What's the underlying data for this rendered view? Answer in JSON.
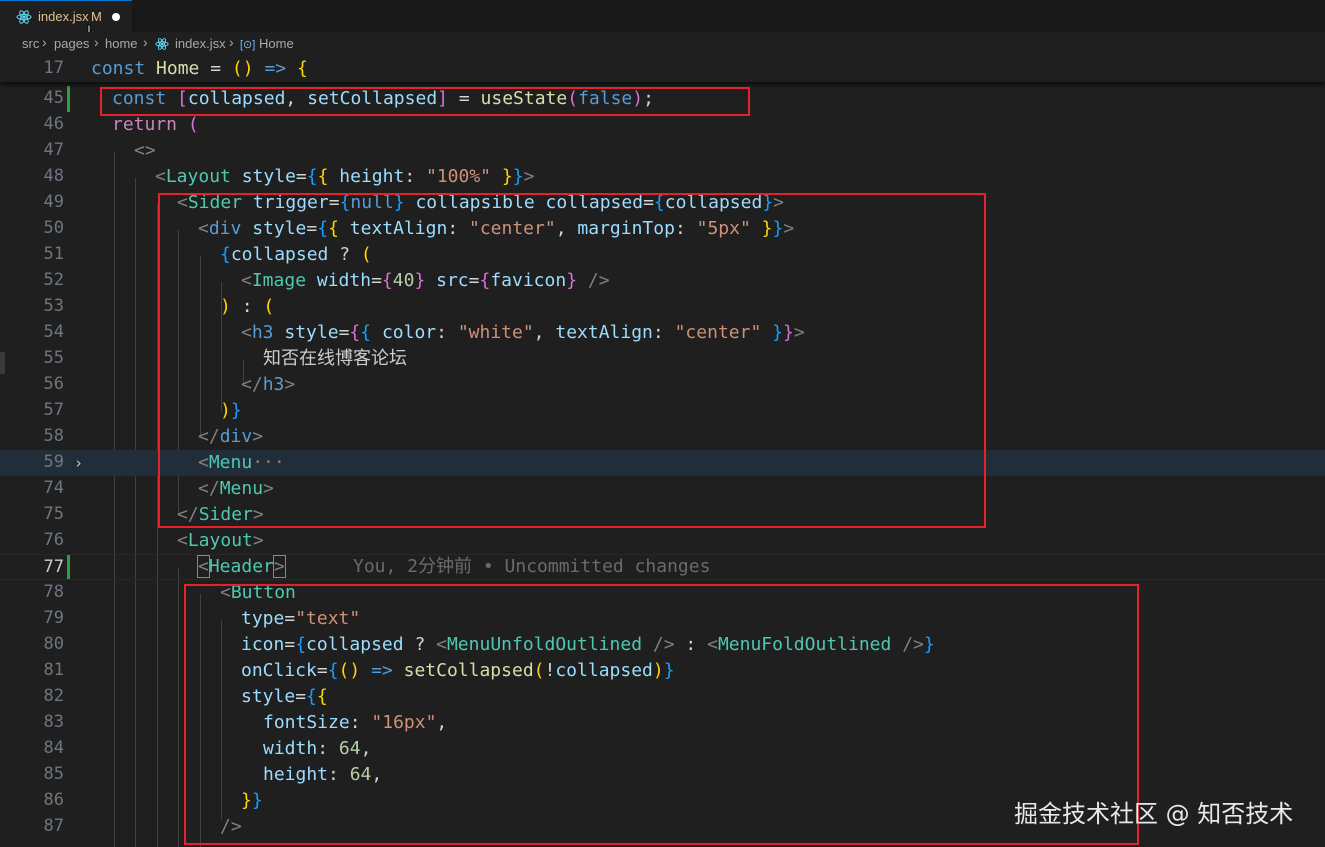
{
  "tab": {
    "filename": "index.jsx",
    "modified": "M"
  },
  "breadcrumb": {
    "parts": [
      "src",
      "pages",
      "home",
      "index.jsx",
      "Home"
    ]
  },
  "editor": {
    "sticky_line_number": "17",
    "line_numbers": [
      "45",
      "46",
      "47",
      "48",
      "49",
      "50",
      "51",
      "52",
      "53",
      "54",
      "55",
      "56",
      "57",
      "58",
      "59",
      "74",
      "75",
      "76",
      "77",
      "78",
      "79",
      "80",
      "81",
      "82",
      "83",
      "84",
      "85",
      "86",
      "87"
    ],
    "blame": "You, 2分钟前 • Uncommitted changes",
    "chinese_text": "知否在线博客论坛"
  },
  "watermark": "掘金技术社区 @ 知否技术",
  "colors": {
    "highlight": "#e5222b",
    "keyword": "#569cd6",
    "component": "#4ec9b0",
    "string": "#ce9178"
  }
}
